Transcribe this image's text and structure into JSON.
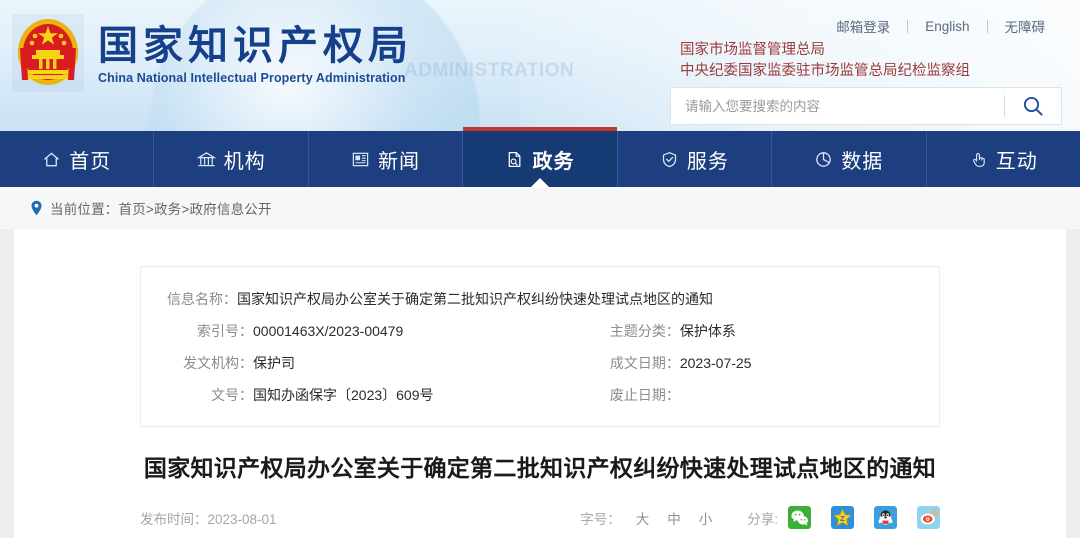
{
  "header": {
    "emblem_icon": "national-emblem-icon",
    "brand_cn": "国家知识产权局",
    "brand_en": "China National Intellectual Property Administration",
    "watermark": "ADMINISTRATION",
    "top_links": [
      {
        "label": "邮箱登录"
      },
      {
        "label": "English"
      },
      {
        "label": "无障碍"
      }
    ],
    "agencies": [
      "国家市场监督管理总局",
      "中央纪委国家监委驻市场监管总局纪检监察组"
    ],
    "agency_color": "#9c3b3b",
    "search": {
      "placeholder": "请输入您要搜索的内容",
      "value": "",
      "icon": "search-icon"
    }
  },
  "nav": {
    "active_index": 3,
    "accent_color": "#c0392b",
    "background": "#1d3f7f",
    "items": [
      {
        "label": "首页",
        "icon": "home-icon"
      },
      {
        "label": "机构",
        "icon": "bank-icon"
      },
      {
        "label": "新闻",
        "icon": "newspaper-icon"
      },
      {
        "label": "政务",
        "icon": "document-search-icon"
      },
      {
        "label": "服务",
        "icon": "shield-check-icon"
      },
      {
        "label": "数据",
        "icon": "pie-chart-icon"
      },
      {
        "label": "互动",
        "icon": "hand-pointer-icon"
      }
    ]
  },
  "breadcrumb": {
    "icon": "location-pin-icon",
    "text": "当前位置：首页>政务>政府信息公开"
  },
  "info_table": {
    "rows": [
      {
        "label": "信息名称",
        "value": "国家知识产权局办公室关于确定第二批知识产权纠纷快速处理试点地区的通知"
      },
      {
        "label": "索引号",
        "value": "00001463X/2023-00479",
        "label2": "主题分类",
        "value2": "保护体系"
      },
      {
        "label": "发文机构",
        "value": "保护司",
        "label2": "成文日期",
        "value2": "2023-07-25"
      },
      {
        "label": "文号",
        "value": "国知办函保字〔2023〕609号",
        "label2": "废止日期",
        "value2": ""
      }
    ]
  },
  "article": {
    "title": "国家知识产权局办公室关于确定第二批知识产权纠纷快速处理试点地区的通知",
    "publish_time": "发布时间：2023-08-01",
    "fontsize_label": "字号：",
    "fontsize_options": [
      {
        "label": "大"
      },
      {
        "label": "中"
      },
      {
        "label": "小"
      }
    ],
    "share_label": "分享:",
    "share_icons": [
      {
        "name": "wechat-icon",
        "color": "#3CB034"
      },
      {
        "name": "favorite-star-icon",
        "color": "#2f8fd8"
      },
      {
        "name": "qq-icon",
        "color": "#3aa0e0"
      },
      {
        "name": "weibo-icon",
        "color": "#8fd3ef"
      }
    ]
  }
}
